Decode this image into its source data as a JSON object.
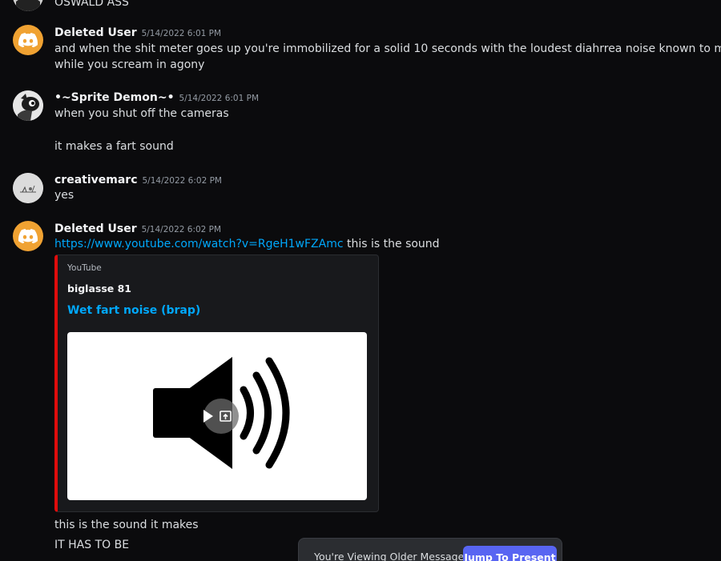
{
  "messages": [
    {
      "lines": [
        "OSWALD ASS"
      ]
    },
    {
      "username": "Deleted User",
      "timestamp": "5/14/2022 6:01 PM",
      "avatar_icon": "discord-logo-icon",
      "lines": [
        "and when the shit meter goes up you're immobilized for a solid 10 seconds with the loudest diahrrea noise known to man",
        "while you scream in agony"
      ]
    },
    {
      "username": "•~Sprite Demon~•",
      "timestamp": "5/14/2022 6:01 PM",
      "avatar_icon": "sprite-demon-avatar",
      "lines": [
        "when you shut off the cameras",
        "it makes a fart sound"
      ]
    },
    {
      "username": "creativemarc",
      "timestamp": "5/14/2022 6:02 PM",
      "avatar_icon": "creativemarc-avatar",
      "lines": [
        "yes"
      ]
    },
    {
      "username": "Deleted User",
      "timestamp": "5/14/2022 6:02 PM",
      "avatar_icon": "discord-logo-icon",
      "link": "https://www.youtube.com/watch?v=RgeH1wFZAmc",
      "link_suffix": " this is the sound",
      "embed": {
        "provider": "YouTube",
        "author": "biglasse 81",
        "title": "Wet fart noise (brap)",
        "thumbnail_icon": "speaker-volume-icon",
        "accent_color": "#e00c0c"
      },
      "followups": [
        "this is the sound it makes",
        "IT HAS TO BE"
      ]
    }
  ],
  "banner": {
    "text": "You're Viewing Older Messages",
    "button_label": "Jump To Present",
    "button_color": "#5865f2"
  }
}
